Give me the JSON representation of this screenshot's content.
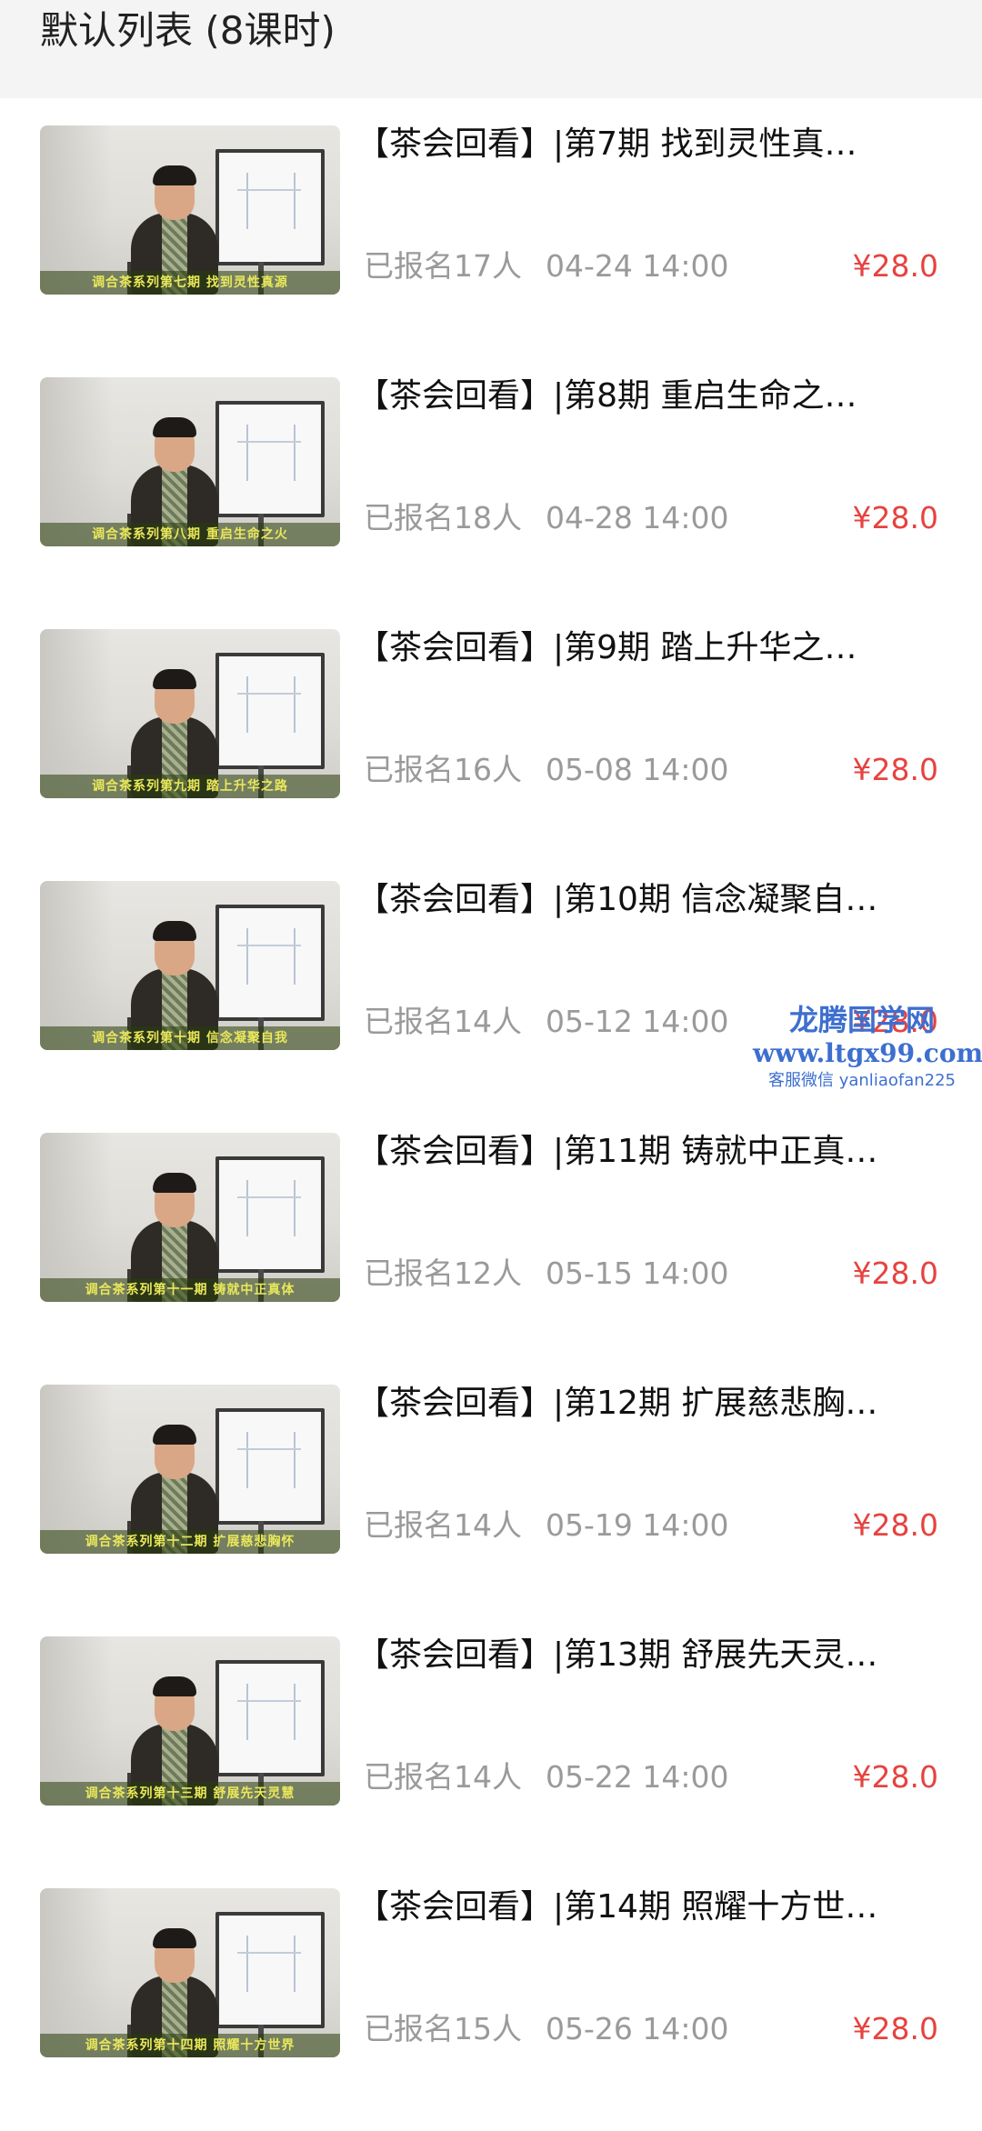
{
  "header": {
    "title": "默认列表 (8课时)"
  },
  "lessons": [
    {
      "title": "【茶会回看】|第7期 找到灵性真…",
      "caption": "调合茶系列第七期 找到灵性真源",
      "enrolled": "已报名17人",
      "datetime": "04-24 14:00",
      "price": "¥28.0"
    },
    {
      "title": "【茶会回看】|第8期 重启生命之…",
      "caption": "调合茶系列第八期 重启生命之火",
      "enrolled": "已报名18人",
      "datetime": "04-28 14:00",
      "price": "¥28.0"
    },
    {
      "title": "【茶会回看】|第9期 踏上升华之…",
      "caption": "调合茶系列第九期 踏上升华之路",
      "enrolled": "已报名16人",
      "datetime": "05-08 14:00",
      "price": "¥28.0"
    },
    {
      "title": "【茶会回看】|第10期 信念凝聚自…",
      "caption": "调合茶系列第十期 信念凝聚自我",
      "enrolled": "已报名14人",
      "datetime": "05-12 14:00",
      "price": "¥28.0"
    },
    {
      "title": "【茶会回看】|第11期 铸就中正真…",
      "caption": "调合茶系列第十一期 铸就中正真体",
      "enrolled": "已报名12人",
      "datetime": "05-15 14:00",
      "price": "¥28.0"
    },
    {
      "title": "【茶会回看】|第12期 扩展慈悲胸…",
      "caption": "调合茶系列第十二期 扩展慈悲胸怀",
      "enrolled": "已报名14人",
      "datetime": "05-19 14:00",
      "price": "¥28.0"
    },
    {
      "title": "【茶会回看】|第13期 舒展先天灵…",
      "caption": "调合茶系列第十三期 舒展先天灵慧",
      "enrolled": "已报名14人",
      "datetime": "05-22 14:00",
      "price": "¥28.0"
    },
    {
      "title": "【茶会回看】|第14期 照耀十方世…",
      "caption": "调合茶系列第十四期 照耀十方世界",
      "enrolled": "已报名15人",
      "datetime": "05-26 14:00",
      "price": "¥28.0"
    }
  ],
  "watermark": {
    "name": "龙腾国学网",
    "url": "www.ltgx99.com",
    "contact": "客服微信 yanliaofan225"
  },
  "colors": {
    "price": "#e64340",
    "meta": "#9a9a9a",
    "header_bg": "#f4f4f4",
    "watermark": "#3d6fd0"
  }
}
